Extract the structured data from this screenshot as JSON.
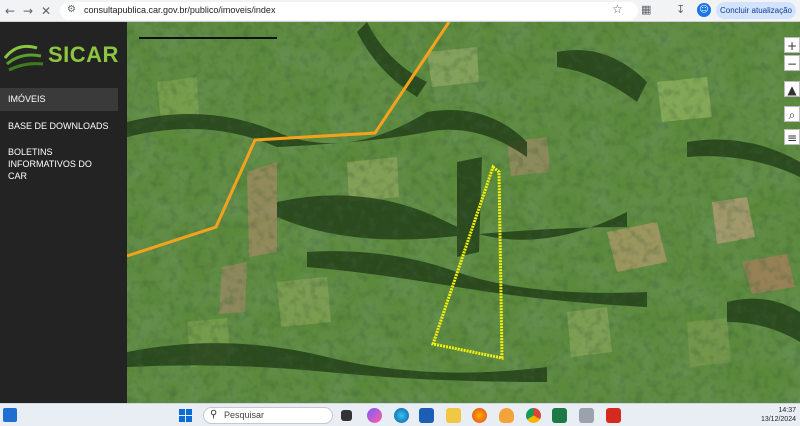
{
  "browser": {
    "url": "consultapublica.car.gov.br/publico/imoveis/index",
    "update_button": "Concluir atualização",
    "avatar": "☺"
  },
  "sidebar": {
    "logo_text": "SICAR",
    "items": [
      {
        "label": "IMÓVEIS",
        "active": true
      },
      {
        "label": "BASE DE DOWNLOADS",
        "active": false
      },
      {
        "label": "BOLETINS INFORMATIVOS DO CAR",
        "active": false
      }
    ]
  },
  "map": {
    "controls": [
      "+",
      "−",
      "▲",
      "⌕",
      "≡"
    ],
    "boundary_color": "#f3a21d",
    "property_color": "#f5f20a"
  },
  "taskbar": {
    "search_placeholder": "Pesquisar",
    "time": "14:37",
    "date": "13/12/2024"
  }
}
